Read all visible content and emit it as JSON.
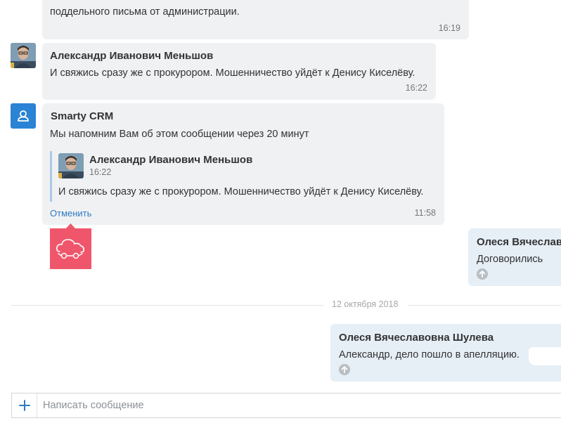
{
  "messages": [
    {
      "text": "поддельного письма от администрации.",
      "time": "16:19"
    },
    {
      "author": "Александр Иванович Меньшов",
      "text": "И свяжись сразу же с прокурором. Мошенничество уйдёт к Денису Киселёву.",
      "time": "16:22",
      "avatar_icon": "user-photo-icon"
    },
    {
      "author": "Smarty CRM",
      "text": "Мы напомним Вам об этом сообщении через 20 минут",
      "time": "11:58",
      "avatar_icon": "user-icon",
      "quote": {
        "author": "Александр Иванович Меньшов",
        "time": "16:22",
        "text": "И свяжись сразу же с прокурором. Мошенничество уйдёт к Денису Киселёву."
      },
      "action_label": "Отменить"
    },
    {
      "author": "Олеся Вячеслав",
      "text": "Договорились",
      "status_icon": "arrow-up-icon"
    },
    {
      "author": "Олеся Вячеславовна Шулева",
      "text": "Александр, дело пошло в апелляцию.",
      "status_icon": "arrow-up-icon"
    }
  ],
  "sticker": {
    "icon": "cloud-car-sticker-icon",
    "color": "#f0566b"
  },
  "date_divider": "12 октября 2018",
  "composer": {
    "placeholder": "Написать сообщение",
    "attach_icon": "plus-icon"
  },
  "colors": {
    "accent": "#2c7bc4",
    "incoming_bubble": "#f0f1f3",
    "outgoing_bubble": "#e6eef6"
  }
}
